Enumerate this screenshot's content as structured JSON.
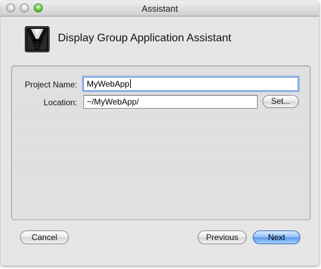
{
  "window": {
    "title": "Assistant"
  },
  "header": {
    "title": "Display Group Application Assistant",
    "icon": "tuxedo-icon"
  },
  "form": {
    "project_name_label": "Project Name:",
    "project_name_value": "MyWebApp",
    "location_label": "Location:",
    "location_value": "~/MyWebApp/",
    "set_button_label": "Set..."
  },
  "footer": {
    "cancel_label": "Cancel",
    "previous_label": "Previous",
    "next_label": "Next"
  },
  "colors": {
    "default_button": "#5a97e9",
    "focus_ring": "#95b6e6"
  }
}
